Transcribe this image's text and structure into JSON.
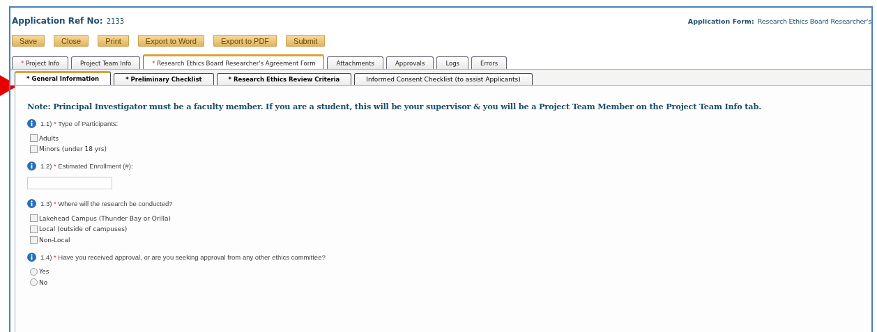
{
  "header": {
    "ref_label": "Application Ref No:",
    "ref_value": "2133",
    "form_label": "Application Form:",
    "form_value": "Research Ethics Board Researcher's"
  },
  "buttons": [
    "Save",
    "Close",
    "Print",
    "Export to Word",
    "Export to PDF",
    "Submit"
  ],
  "tabs": [
    {
      "marker": "*",
      "label": "Project Info",
      "selected": false
    },
    {
      "label": "Project Team Info",
      "selected": false
    },
    {
      "marker": "*",
      "label": "Research Ethics Board Researcher's Agreement Form",
      "selected": true
    },
    {
      "label": "Attachments",
      "selected": false
    },
    {
      "label": "Approvals",
      "selected": false
    },
    {
      "label": "Logs",
      "selected": false
    },
    {
      "label": "Errors",
      "selected": false
    }
  ],
  "subtabs": [
    {
      "marker": "*",
      "label": "General Information",
      "selected": true
    },
    {
      "marker": "*",
      "label": "Preliminary Checklist",
      "selected": false
    },
    {
      "marker": "*",
      "label": "Research Ethics Review Criteria",
      "selected": false
    },
    {
      "label": "Informed Consent Checklist (to assist Applicants)",
      "selected": false
    }
  ],
  "note": "Note: Principal Investigator must be a faculty member. If you are a student, this will be your supervisor & you will be a Project Team Member on the Project Team Info tab.",
  "questions": [
    {
      "number": "1.1)",
      "marker": "*",
      "text": "Type of Participants:",
      "kind": "checkbox",
      "options": [
        {
          "label": "Adults",
          "checked": false
        },
        {
          "label": "Minors (under 18 yrs)",
          "checked": false
        }
      ]
    },
    {
      "number": "1.2)",
      "marker": "*",
      "text": "Estimated Enrollment (#):",
      "kind": "text"
    },
    {
      "number": "1.3)",
      "marker": "*",
      "text": "Where will the research be conducted?",
      "kind": "checkbox",
      "options": [
        {
          "label": "Lakehead Campus (Thunder Bay or Orilla)",
          "checked": false
        },
        {
          "label": "Local (outside of campuses)",
          "checked": false
        },
        {
          "label": "Non-Local",
          "checked": false
        }
      ]
    },
    {
      "number": "1.4)",
      "marker": "*",
      "text": "Have you received approval, or are you seeking approval from any other ethics committee?",
      "kind": "radio",
      "options": [
        {
          "label": "Yes",
          "selected": false
        },
        {
          "label": "No",
          "selected": false
        }
      ]
    }
  ]
}
